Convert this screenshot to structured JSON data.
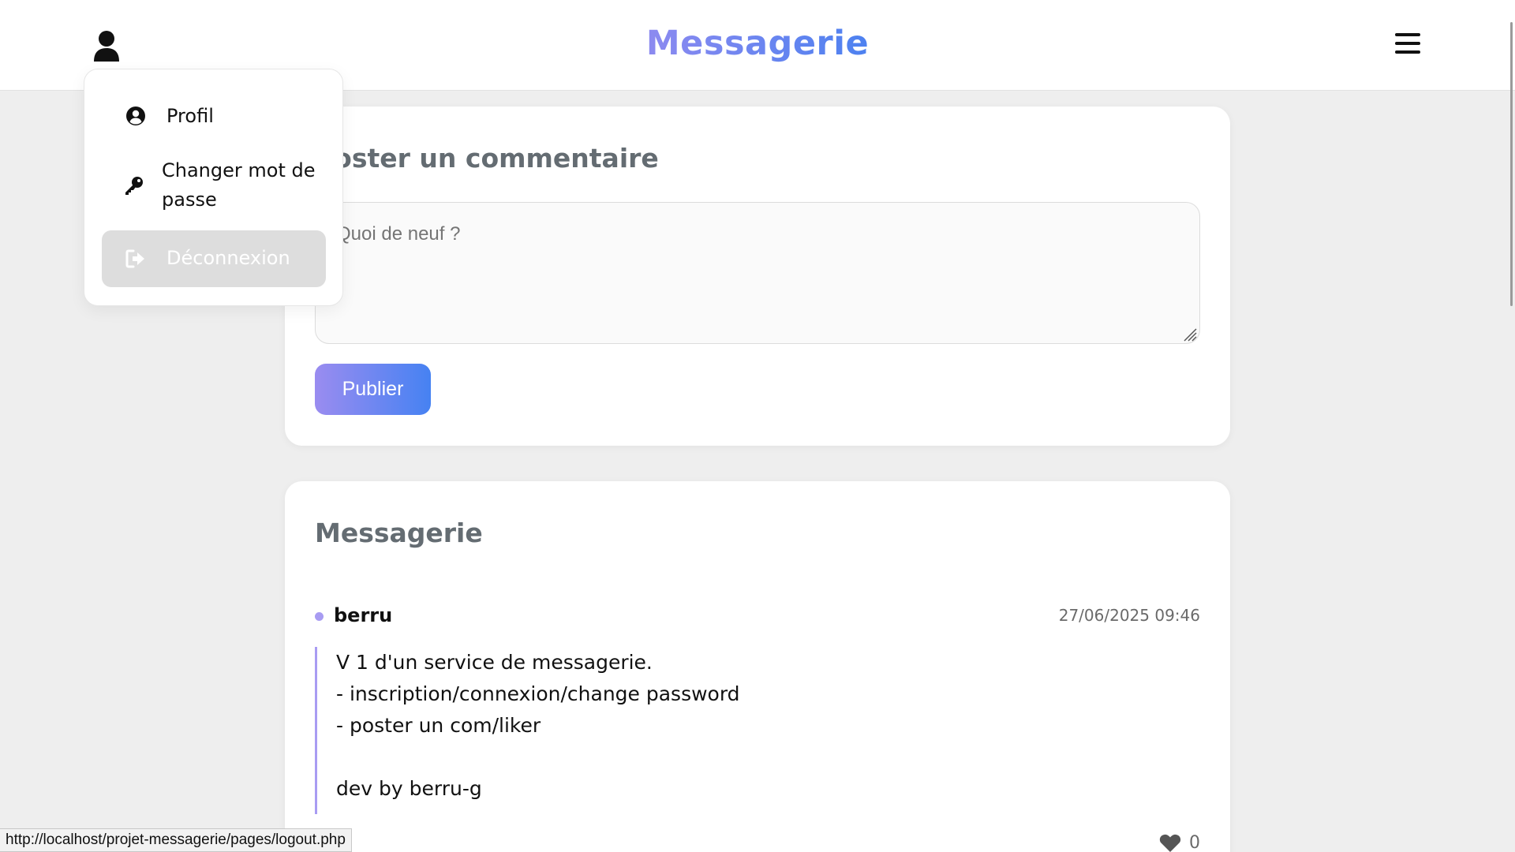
{
  "header": {
    "title": "Messagerie",
    "user_icon": "user-icon",
    "menu_icon": "hamburger-menu-icon",
    "title_gradient": [
      "#9a8cf0",
      "#3f7ff0"
    ]
  },
  "user_menu": {
    "items": [
      {
        "label": "Profil",
        "icon": "user-circle-icon"
      },
      {
        "label": "Changer mot de passe",
        "icon": "key-icon"
      },
      {
        "label": "Déconnexion",
        "icon": "sign-out-icon",
        "state": "hover"
      }
    ]
  },
  "composer": {
    "title": "Poster un commentaire",
    "placeholder": "Quoi de neuf ?",
    "submit_label": "Publier"
  },
  "feed": {
    "title": "Messagerie",
    "posts": [
      {
        "author": "berru",
        "date": "27/06/2025 09:46",
        "lines": [
          "V 1 d'un service de messagerie.",
          "- inscription/connexion/change password",
          "- poster un com/liker",
          "",
          "dev by berru-g"
        ],
        "likes": "0",
        "like_icon": "heart-icon"
      }
    ]
  },
  "statusbar": {
    "url": "http://localhost/projet-messagerie/pages/logout.php"
  },
  "colors": {
    "accent": "#9a8cf0",
    "accent2": "#4682f2",
    "background": "#eeeeee"
  }
}
